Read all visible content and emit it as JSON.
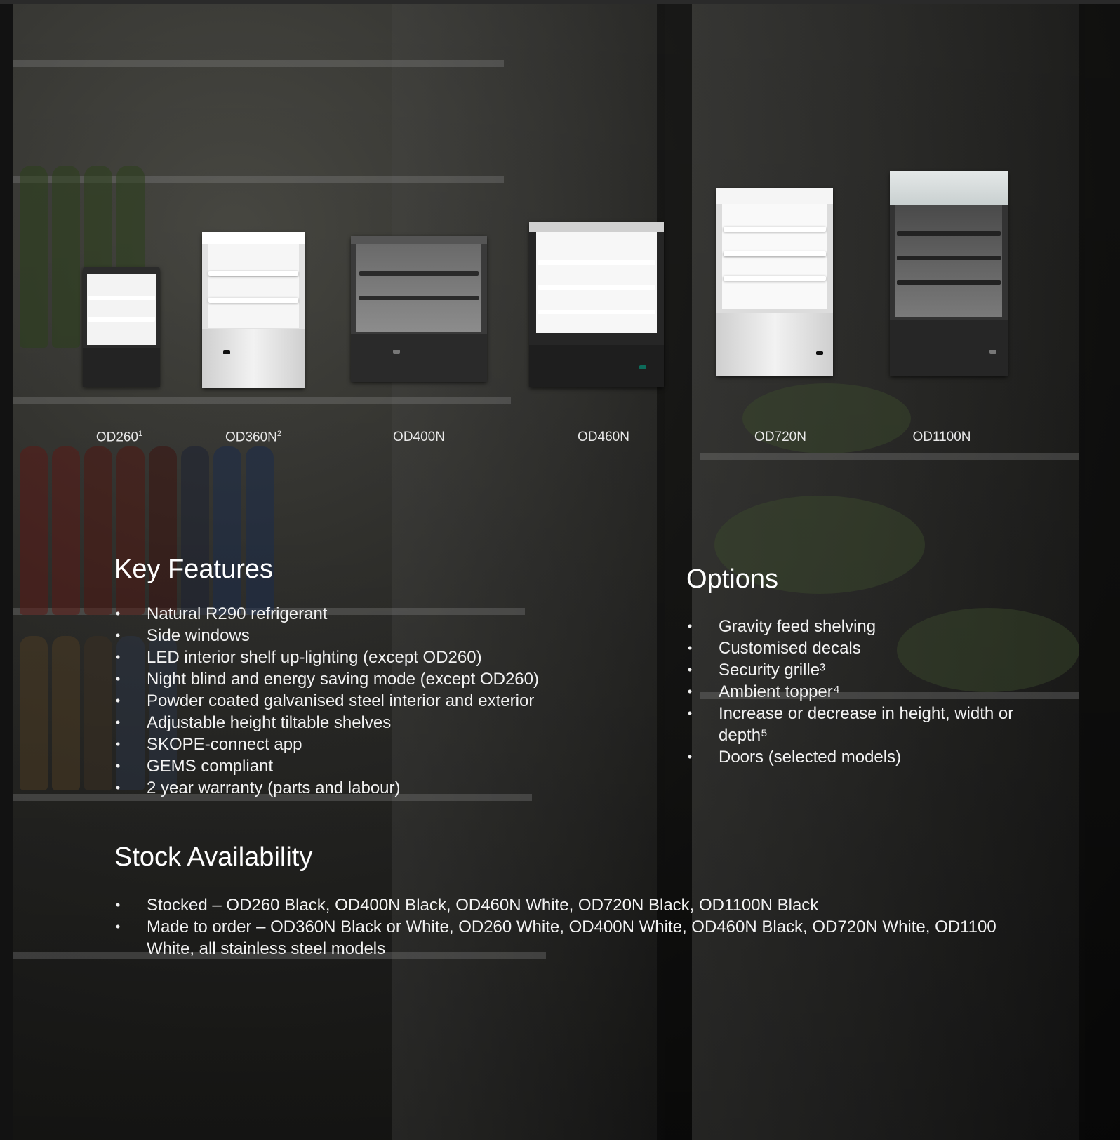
{
  "models": [
    {
      "name": "OD260",
      "mark": "1",
      "finish": "black"
    },
    {
      "name": "OD360N",
      "mark": "2",
      "finish": "white"
    },
    {
      "name": "OD400N",
      "mark": "",
      "finish": "black"
    },
    {
      "name": "OD460N",
      "mark": "",
      "finish": "black"
    },
    {
      "name": "OD720N",
      "mark": "",
      "finish": "white"
    },
    {
      "name": "OD1100N",
      "mark": "",
      "finish": "dark"
    }
  ],
  "key_features": {
    "title": "Key Features",
    "items": [
      "Natural R290 refrigerant",
      "Side windows",
      "LED interior shelf up-lighting (except OD260)",
      "Night blind and energy saving mode (except OD260)",
      "Powder coated galvanised steel interior and exterior",
      "Adjustable height tiltable shelves",
      "SKOPE-connect app",
      "GEMS compliant",
      "2 year warranty (parts and labour)"
    ]
  },
  "options": {
    "title": "Options",
    "items": [
      "Gravity feed shelving",
      "Customised decals",
      "Security grille³",
      "Ambient topper⁴",
      "Increase or decrease in height, width or depth⁵",
      "Doors (selected models)"
    ]
  },
  "stock": {
    "title": "Stock Availability",
    "items": [
      "Stocked – OD260 Black, OD400N Black, OD460N White, OD720N Black, OD1100N Black",
      "Made to order – OD360N Black or White, OD260 White, OD400N White, OD460N Black, OD720N White, OD1100 White, all stainless steel models"
    ]
  },
  "bullet": "•",
  "colors": {
    "white_fridge": "#e9e9e9",
    "black_fridge": "#2a2a2a",
    "interior_light": "#f4f4f4",
    "text": "#ffffff"
  }
}
